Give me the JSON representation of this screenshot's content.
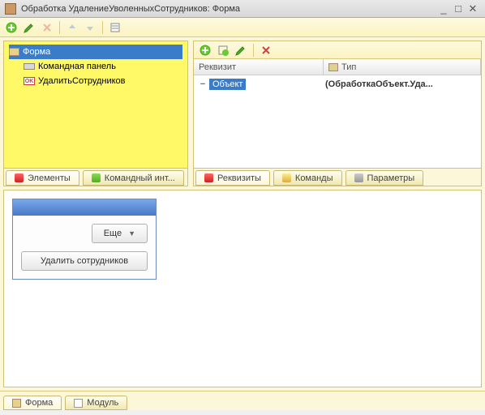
{
  "title": "Обработка УдалениеУволенныхСотрудников: Форма",
  "left_tree": {
    "root": "Форма",
    "items": [
      {
        "label": "Командная панель"
      },
      {
        "label": "УдалитьСотрудников",
        "ok": true
      }
    ]
  },
  "left_tabs": {
    "elements": "Элементы",
    "cmd_int": "Командный инт..."
  },
  "right_grid": {
    "col_attr": "Реквизит",
    "col_type": "Тип",
    "row_object": "Объект",
    "row_type": "(ОбработкаОбъект.Уда..."
  },
  "right_tabs": {
    "attrs": "Реквизиты",
    "cmds": "Команды",
    "params": "Параметры"
  },
  "preview": {
    "more": "Еще",
    "delete": "Удалить сотрудников"
  },
  "bottom_tabs": {
    "form": "Форма",
    "module": "Модуль"
  }
}
